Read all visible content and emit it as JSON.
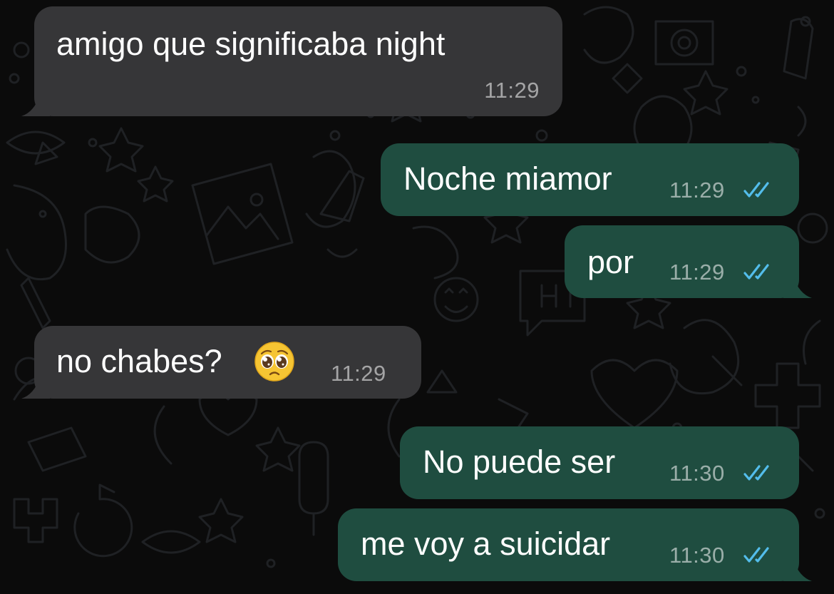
{
  "conversation": {
    "messages": [
      {
        "direction": "incoming",
        "text": "amigo que significaba night",
        "time": "11:29"
      },
      {
        "direction": "outgoing",
        "text": "Noche miamor",
        "time": "11:29",
        "status": "read"
      },
      {
        "direction": "outgoing",
        "text": "por",
        "time": "11:29",
        "status": "read"
      },
      {
        "direction": "incoming",
        "text": "no chabes?",
        "emoji": "pleading-face",
        "time": "11:29"
      },
      {
        "direction": "outgoing",
        "text": "No puede ser",
        "time": "11:30",
        "status": "read"
      },
      {
        "direction": "outgoing",
        "text": "me voy a suicidar",
        "time": "11:30",
        "status": "read"
      }
    ]
  },
  "colors": {
    "background": "#0b0b0b",
    "incoming_bubble": "#363638",
    "outgoing_bubble": "#1f4d40",
    "read_ticks": "#53bdeb"
  },
  "icons": {
    "read_receipt": "double-check-icon",
    "emoji": "pleading-face-emoji"
  }
}
